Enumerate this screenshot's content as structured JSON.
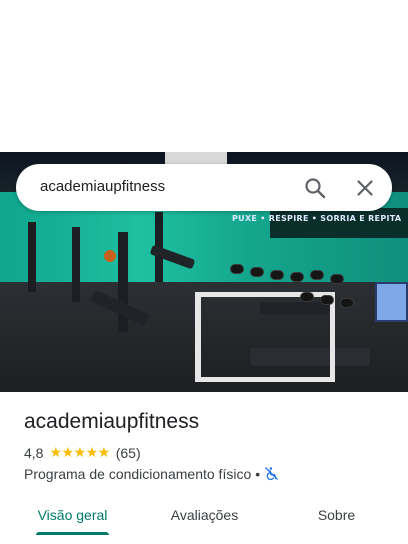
{
  "search": {
    "query": "academiaupfitness"
  },
  "hero": {
    "wall_text": "PUXE • RESPIRE • SORRIA E REPITA"
  },
  "place": {
    "name": "academiaupfitness",
    "rating": "4,8",
    "stars": "★★★★★",
    "review_count": "(65)",
    "category": "Programa de condicionamento físico",
    "separator": "•"
  },
  "tabs": [
    {
      "label": "Visão geral",
      "active": true
    },
    {
      "label": "Avaliações",
      "active": false
    },
    {
      "label": "Sobre",
      "active": false
    }
  ],
  "colors": {
    "accent": "#00796b",
    "star": "#fbbc04",
    "accessibility_icon": "#1a73e8"
  },
  "icons": {
    "search": "search-icon",
    "close": "close-icon",
    "accessibility": "wheelchair-not-accessible-icon"
  }
}
